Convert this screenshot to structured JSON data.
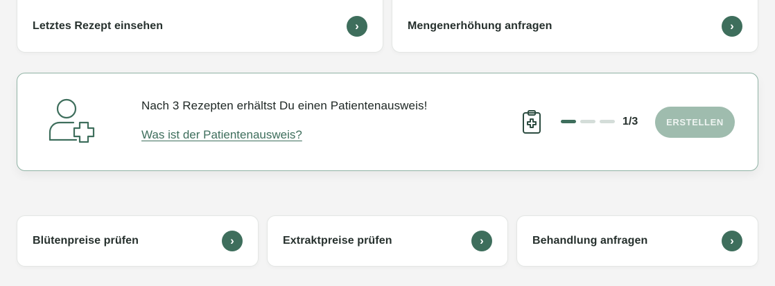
{
  "colors": {
    "accent": "#3e6e5c",
    "accent_disabled": "#9fbcae",
    "progress_empty": "#d4ddd9",
    "card_border_highlight": "#8fb2a4",
    "background": "#f4f4f4"
  },
  "top_actions": [
    {
      "label": "Letztes Rezept einsehen",
      "icon": "chevron-right-icon"
    },
    {
      "label": "Mengenerhöhung anfragen",
      "icon": "chevron-right-icon"
    }
  ],
  "patient_card": {
    "icon": "user-plus-icon",
    "title": "Nach 3 Rezepten erhältst Du einen Patientenausweis!",
    "link": "Was ist der Patientenausweis?",
    "progress_icon": "clipboard-medical-icon",
    "progress": {
      "current": 1,
      "total": 3,
      "label": "1/3"
    },
    "button_label": "ERSTELLEN",
    "button_enabled": false
  },
  "bottom_actions": [
    {
      "label": "Blütenpreise prüfen",
      "icon": "chevron-right-icon"
    },
    {
      "label": "Extraktpreise prüfen",
      "icon": "chevron-right-icon"
    },
    {
      "label": "Behandlung anfragen",
      "icon": "chevron-right-icon"
    }
  ],
  "chevron_glyph": "›"
}
